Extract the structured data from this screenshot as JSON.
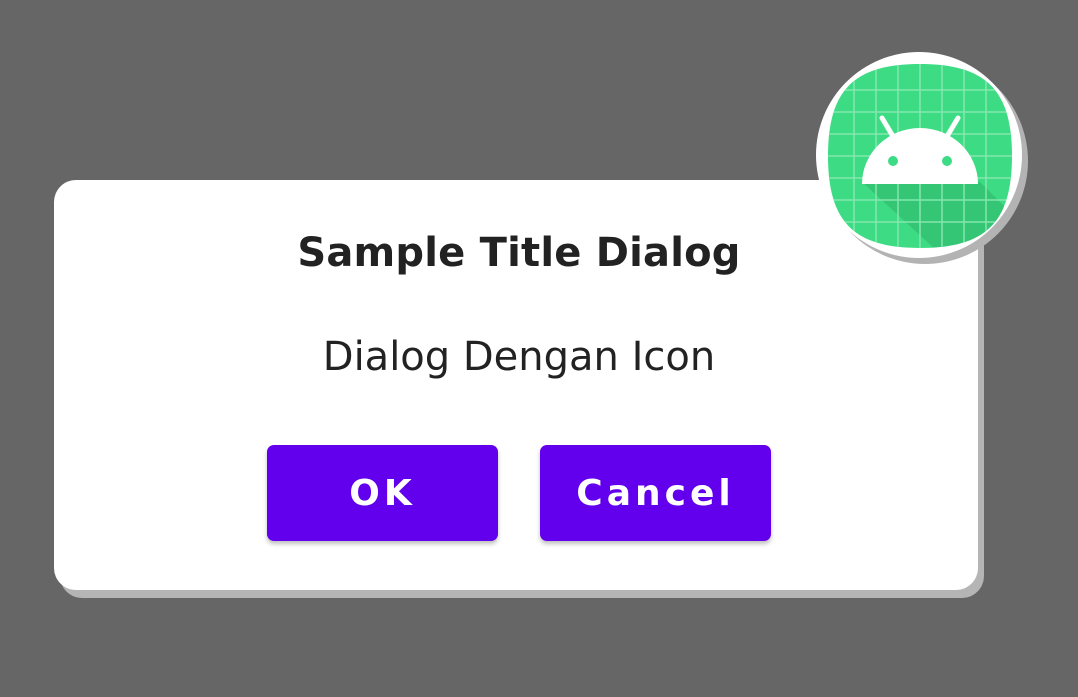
{
  "dialog": {
    "title": "Sample Title Dialog",
    "message": "Dialog Dengan Icon",
    "buttons": {
      "ok_label": "OK",
      "cancel_label": "Cancel"
    },
    "icon": "android-app-icon"
  },
  "colors": {
    "scrim": "#666666",
    "dialog_background": "#ffffff",
    "button_primary": "#6200ee",
    "button_text": "#ffffff",
    "title_text": "#222222",
    "icon_green": "#3ddc84"
  }
}
